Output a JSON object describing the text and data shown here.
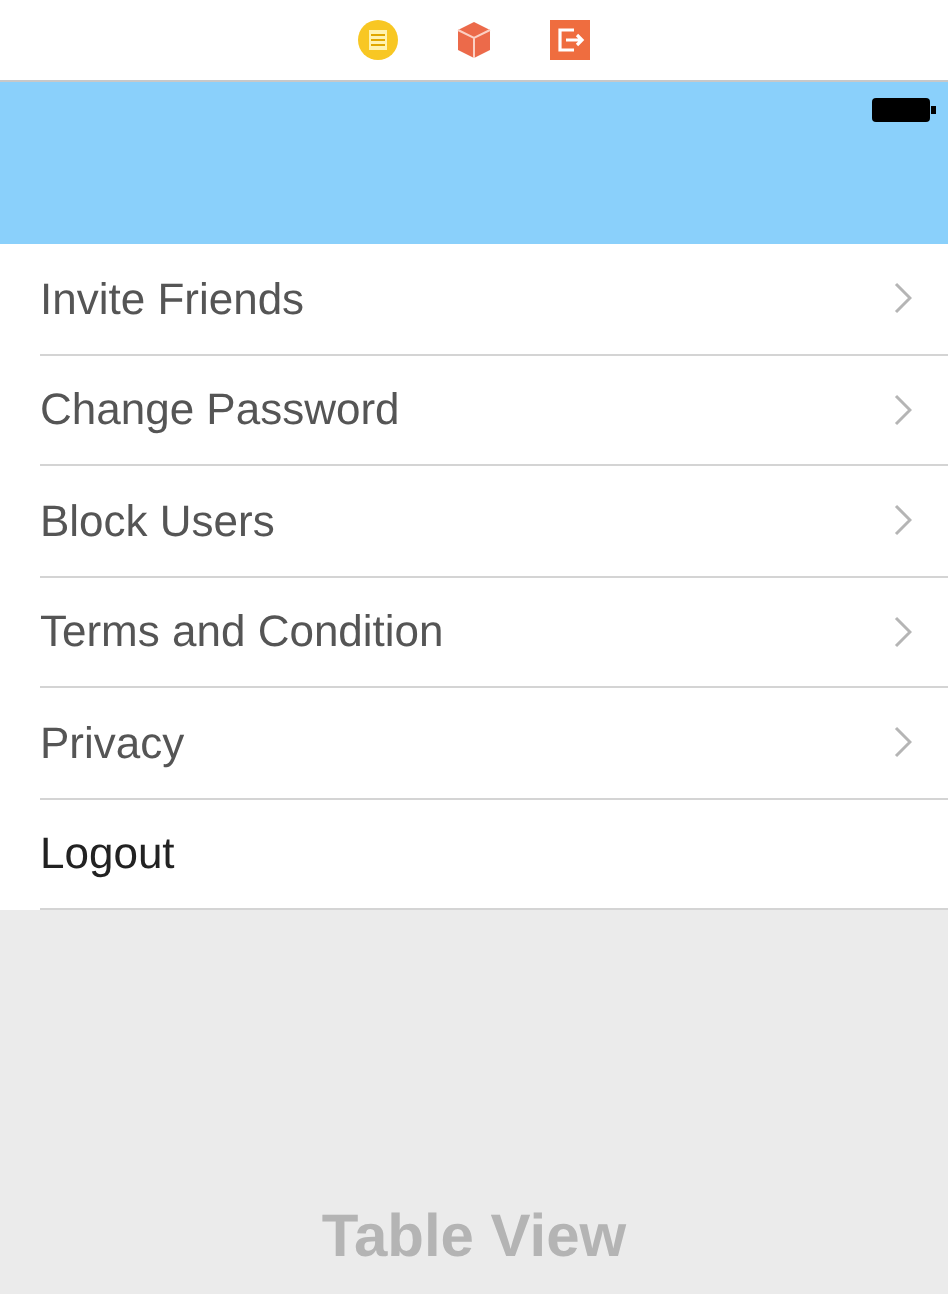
{
  "menu_items": [
    {
      "label": "Invite Friends",
      "kind": "disclosure"
    },
    {
      "label": "Change Password",
      "kind": "disclosure"
    },
    {
      "label": "Block Users",
      "kind": "disclosure"
    },
    {
      "label": "Terms and Condition",
      "kind": "disclosure"
    },
    {
      "label": "Privacy",
      "kind": "disclosure"
    },
    {
      "label": "Logout",
      "kind": "action"
    }
  ],
  "placeholder_label": "Table View"
}
